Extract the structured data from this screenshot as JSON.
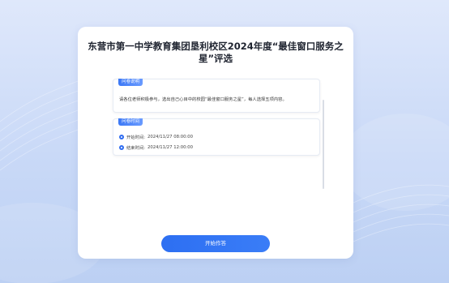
{
  "survey": {
    "title": "东营市第一中学教育集团垦利校区2024年度“最佳窗口服务之星”评选"
  },
  "description_section": {
    "tag": "问卷说明",
    "text": "请各位老师积极参与，选出自己心目中的校园“最佳窗口服务之星”，每人选择五项内容。"
  },
  "time_section": {
    "tag": "问卷时间",
    "start_label": "开始时间:",
    "start_value": "2024/11/27 08:00:00",
    "end_label": "结束时间:",
    "end_value": "2024/11/27 12:00:00"
  },
  "actions": {
    "start_button": "开始作答"
  },
  "colors": {
    "accent": "#2f6cf0",
    "background": "#c9d9f7",
    "card": "#ffffff"
  }
}
